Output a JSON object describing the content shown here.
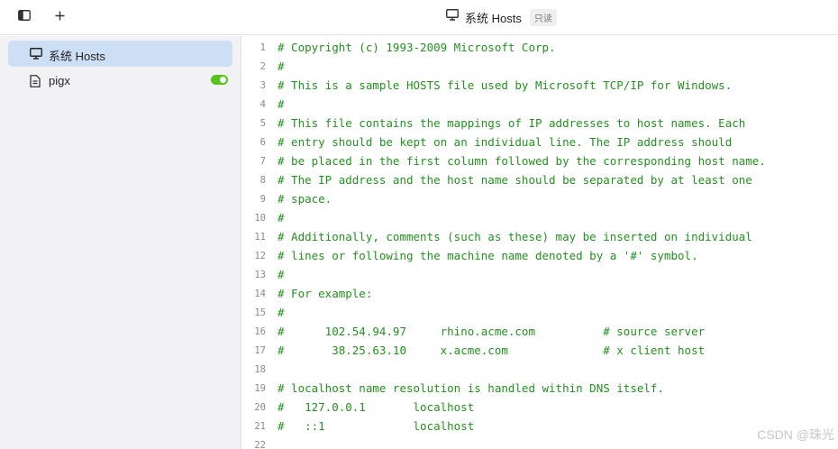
{
  "topbar": {
    "title": "系统 Hosts",
    "badge": "只读"
  },
  "sidebar": {
    "items": [
      {
        "label": "系统 Hosts",
        "icon": "monitor-icon",
        "active": true
      },
      {
        "label": "pigx",
        "icon": "file-icon",
        "enabled": true
      }
    ]
  },
  "editor": {
    "lines": [
      {
        "n": "1",
        "text": "# Copyright (c) 1993-2009 Microsoft Corp."
      },
      {
        "n": "2",
        "text": "#"
      },
      {
        "n": "3",
        "text": "# This is a sample HOSTS file used by Microsoft TCP/IP for Windows."
      },
      {
        "n": "4",
        "text": "#"
      },
      {
        "n": "5",
        "text": "# This file contains the mappings of IP addresses to host names. Each"
      },
      {
        "n": "6",
        "text": "# entry should be kept on an individual line. The IP address should"
      },
      {
        "n": "7",
        "text": "# be placed in the first column followed by the corresponding host name."
      },
      {
        "n": "8",
        "text": "# The IP address and the host name should be separated by at least one"
      },
      {
        "n": "9",
        "text": "# space."
      },
      {
        "n": "10",
        "text": "#"
      },
      {
        "n": "11",
        "text": "# Additionally, comments (such as these) may be inserted on individual"
      },
      {
        "n": "12",
        "text": "# lines or following the machine name denoted by a '#' symbol."
      },
      {
        "n": "13",
        "text": "#"
      },
      {
        "n": "14",
        "text": "# For example:"
      },
      {
        "n": "15",
        "text": "#"
      },
      {
        "n": "16",
        "text": "#      102.54.94.97     rhino.acme.com          # source server"
      },
      {
        "n": "17",
        "text": "#       38.25.63.10     x.acme.com              # x client host"
      },
      {
        "n": "18",
        "text": ""
      },
      {
        "n": "19",
        "text": "# localhost name resolution is handled within DNS itself."
      },
      {
        "n": "20",
        "text": "#   127.0.0.1       localhost"
      },
      {
        "n": "21",
        "text": "#   ::1             localhost"
      },
      {
        "n": "22",
        "text": ""
      }
    ]
  },
  "watermark": "CSDN @珠光",
  "colors": {
    "comment": "#23911e",
    "active_item": "#cddff5",
    "toggle_on": "#52c41a"
  }
}
